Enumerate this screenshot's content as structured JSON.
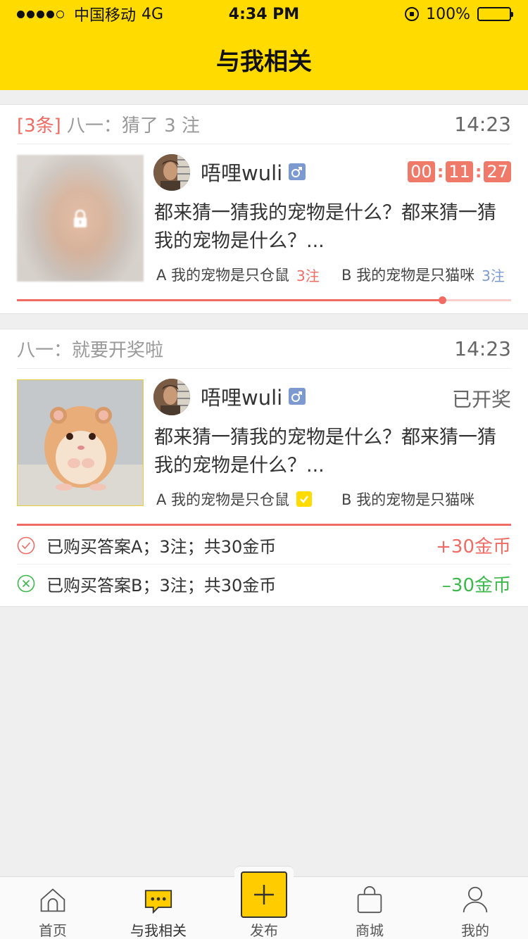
{
  "status_bar": {
    "carrier": "中国移动",
    "network": "4G",
    "time": "4:34 PM",
    "battery": "100%"
  },
  "header": {
    "title": "与我相关"
  },
  "card1": {
    "count_tag": "[3条]",
    "title": "八一：猜了 3 注",
    "time": "14:23",
    "username": "唔哩wuli",
    "gender_symbol": "♂",
    "countdown": {
      "hours": "00",
      "minutes": "11",
      "seconds": "27"
    },
    "description": "都来猜一猜我的宠物是什么？都来猜一猜我的宠物是什么？...",
    "option_a": {
      "label": "A 我的宠物是只仓鼠",
      "bets": "3注"
    },
    "option_b": {
      "label": "B 我的宠物是只猫咪",
      "bets": "3注"
    },
    "progress": 0.86
  },
  "card2": {
    "title": "八一：就要开奖啦",
    "time": "14:23",
    "username": "唔哩wuli",
    "gender_symbol": "♂",
    "status": "已开奖",
    "description": "都来猜一猜我的宠物是什么？都来猜一猜我的宠物是什么？...",
    "option_a": {
      "label": "A 我的宠物是只仓鼠"
    },
    "option_b": {
      "label": "B 我的宠物是只猫咪"
    },
    "results": [
      {
        "text": "已购买答案A；3注；共30金币",
        "amount": "+30金币",
        "win": true
      },
      {
        "text": "已购买答案B；3注；共30金币",
        "amount": "–30金币",
        "win": false
      }
    ]
  },
  "tabbar": {
    "home": "首页",
    "related": "与我相关",
    "publish": "发布",
    "mall": "商城",
    "mine": "我的"
  },
  "colors": {
    "brand_yellow": "#ffdb00",
    "accent_red": "#f06b63",
    "success_green": "#3cb94a",
    "male_blue": "#7c9ad0"
  }
}
